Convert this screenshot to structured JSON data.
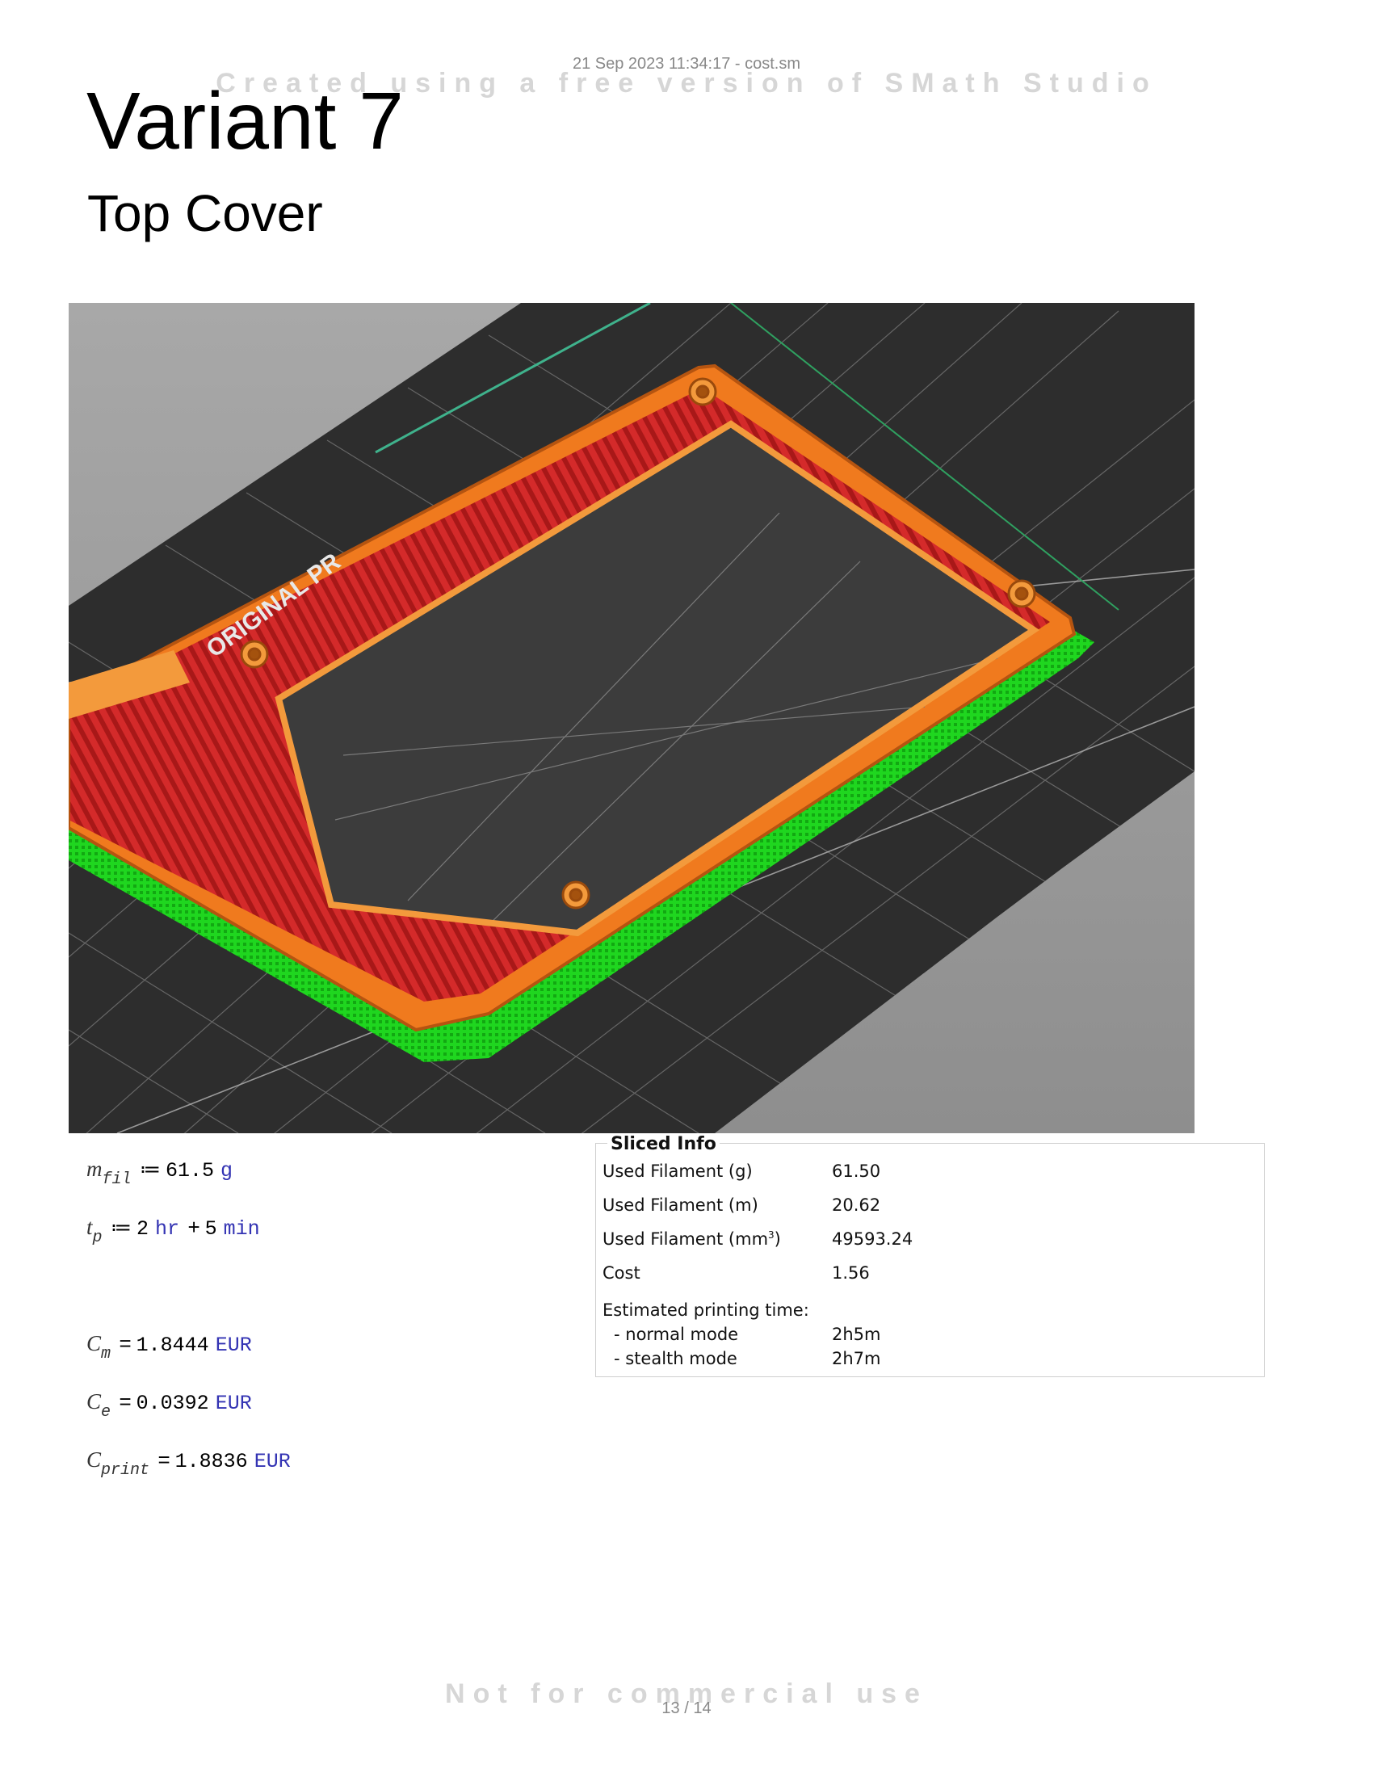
{
  "header": {
    "timestamp": "21 Sep 2023 11:34:17 - cost.sm",
    "watermark": "Created using a free version of SMath Studio"
  },
  "title": "Variant 7",
  "subtitle": "Top Cover",
  "render_image": {
    "printer_bed_text": "ORIGINAL PR",
    "colors": {
      "bed": "#2b2b2b",
      "perimeter": "#f07a1e",
      "infill": "#d32b2b",
      "support": "#21d820",
      "background": "#9a9a9a"
    }
  },
  "formulas": {
    "m_fil": {
      "var": "m",
      "sub": "fil",
      "op": "≔",
      "value": "61.5",
      "unit": "g"
    },
    "t_p": {
      "var": "t",
      "sub": "p",
      "op": "≔",
      "value1": "2",
      "unit1": "hr",
      "plus": "+",
      "value2": "5",
      "unit2": "min"
    },
    "C_m": {
      "var": "C",
      "sub": "m",
      "op": "=",
      "value": "1.8444",
      "unit": "EUR"
    },
    "C_e": {
      "var": "C",
      "sub": "e",
      "op": "=",
      "value": "0.0392",
      "unit": "EUR"
    },
    "C_print": {
      "var": "C",
      "sub": "print",
      "op": "=",
      "value": "1.8836",
      "unit": "EUR"
    }
  },
  "sliced_info": {
    "title": "Sliced Info",
    "used_filament_g": {
      "label": "Used Filament (g)",
      "value": "61.50"
    },
    "used_filament_m": {
      "label": "Used Filament (m)",
      "value": "20.62"
    },
    "used_filament_mm3": {
      "label": "Used Filament (mm",
      "label_sup": "3",
      "label_end": ")",
      "value": "49593.24"
    },
    "cost": {
      "label": "Cost",
      "value": "1.56"
    },
    "est_time": {
      "label": "Estimated printing time:"
    },
    "normal_mode": {
      "label": "- normal mode",
      "value": "2h5m"
    },
    "stealth_mode": {
      "label": "- stealth mode",
      "value": "2h7m"
    }
  },
  "footer": {
    "watermark": "Not for commercial use",
    "page_number": "13 / 14"
  }
}
